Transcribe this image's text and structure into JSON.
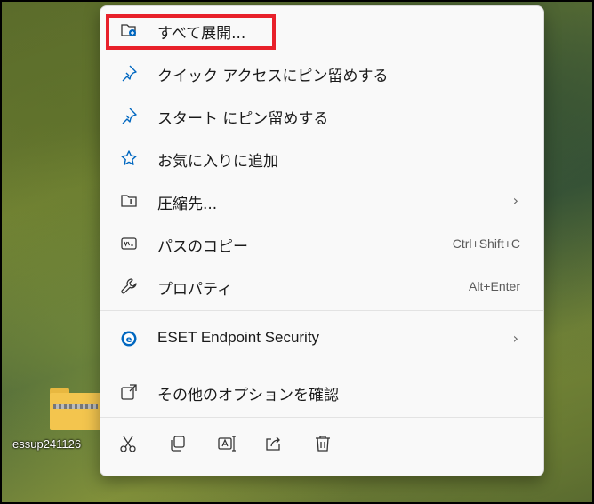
{
  "desktop": {
    "file_label": "essup241126"
  },
  "menu": {
    "items": [
      {
        "label": "すべて展開...",
        "icon": "folder-extract-icon"
      },
      {
        "label": "クイック アクセスにピン留めする",
        "icon": "pin-icon"
      },
      {
        "label": "スタート にピン留めする",
        "icon": "pin-icon"
      },
      {
        "label": "お気に入りに追加",
        "icon": "star-icon"
      },
      {
        "label": "圧縮先...",
        "icon": "zip-folder-icon",
        "submenu": true
      },
      {
        "label": "パスのコピー",
        "icon": "path-copy-icon",
        "shortcut": "Ctrl+Shift+C"
      },
      {
        "label": "プロパティ",
        "icon": "wrench-icon",
        "shortcut": "Alt+Enter"
      },
      {
        "label": "ESET Endpoint Security",
        "icon": "eset-icon",
        "submenu": true
      },
      {
        "label": "その他のオプションを確認",
        "icon": "more-options-icon"
      }
    ],
    "quick_actions": [
      "cut-icon",
      "copy-icon",
      "rename-icon",
      "share-icon",
      "delete-icon"
    ],
    "chevron": "›"
  },
  "colors": {
    "highlight": "#e8202a",
    "accent": "#0067c0"
  }
}
